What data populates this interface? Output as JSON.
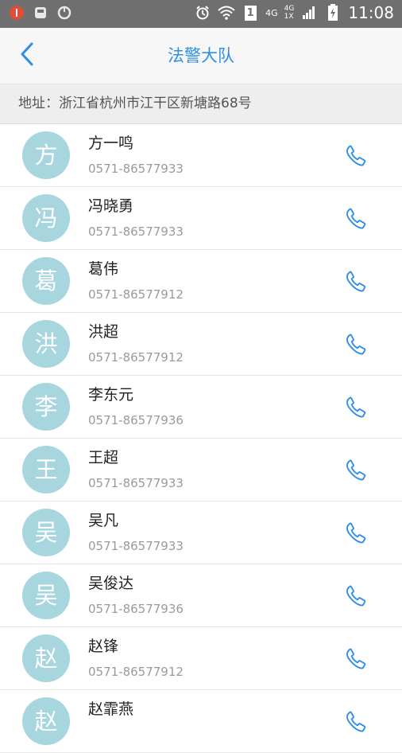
{
  "status_bar": {
    "net_label": "4G",
    "net2_top": "4G",
    "net2_bottom": "1X",
    "sim_label": "1",
    "time": "11:08"
  },
  "app_bar": {
    "title": "法警大队"
  },
  "address": {
    "text": "地址：浙江省杭州市江干区新塘路68号"
  },
  "contacts": [
    {
      "avatar": "方",
      "name": "方一鸣",
      "phone": "0571-86577933"
    },
    {
      "avatar": "冯",
      "name": "冯晓勇",
      "phone": "0571-86577933"
    },
    {
      "avatar": "葛",
      "name": "葛伟",
      "phone": "0571-86577912"
    },
    {
      "avatar": "洪",
      "name": "洪超",
      "phone": "0571-86577912"
    },
    {
      "avatar": "李",
      "name": "李东元",
      "phone": "0571-86577936"
    },
    {
      "avatar": "王",
      "name": "王超",
      "phone": "0571-86577933"
    },
    {
      "avatar": "吴",
      "name": "吴凡",
      "phone": "0571-86577933"
    },
    {
      "avatar": "吴",
      "name": "吴俊达",
      "phone": "0571-86577936"
    },
    {
      "avatar": "赵",
      "name": "赵锋",
      "phone": "0571-86577912"
    },
    {
      "avatar": "赵",
      "name": "赵霏燕",
      "phone": ""
    }
  ],
  "colors": {
    "accent": "#2f8fe5",
    "avatar_bg": "#a7d6df",
    "status_bar": "#6f6f6f"
  },
  "icons": {
    "back": "chevron-left-icon",
    "call": "phone-icon"
  }
}
